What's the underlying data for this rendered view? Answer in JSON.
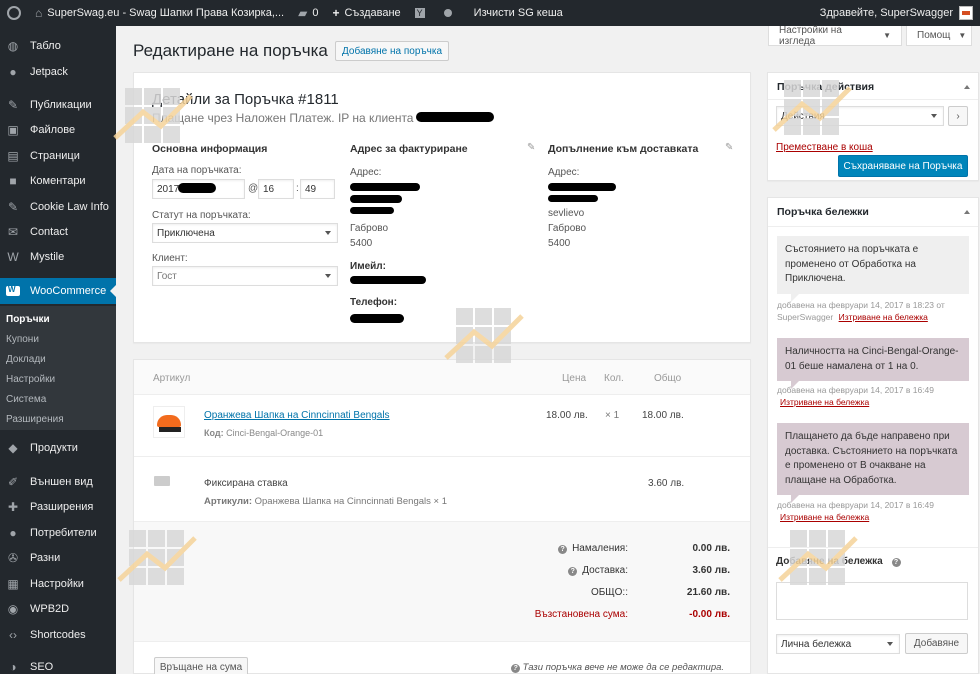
{
  "adminbar": {
    "site_name": "SuperSwag.eu - Swag Шапки Права Козирка,...",
    "comments_count": "0",
    "new_label": "Създаване",
    "purge_label": "Изчисти SG кеша",
    "greeting": "Здравейте, SuperSwagger"
  },
  "sidebar": {
    "items": [
      {
        "label": "Табло",
        "icon": "dashboard-icon",
        "glyph": "◍"
      },
      {
        "label": "Jetpack",
        "icon": "jetpack-icon",
        "glyph": "●"
      },
      {
        "label": "Публикации",
        "icon": "pin-icon",
        "glyph": "✎"
      },
      {
        "label": "Файлове",
        "icon": "media-icon",
        "glyph": "▣"
      },
      {
        "label": "Страници",
        "icon": "page-icon",
        "glyph": "▤"
      },
      {
        "label": "Коментари",
        "icon": "comment-icon",
        "glyph": "■"
      },
      {
        "label": "Cookie Law Info",
        "icon": "pin-icon",
        "glyph": "✎"
      },
      {
        "label": "Contact",
        "icon": "mail-icon",
        "glyph": "✉"
      },
      {
        "label": "Mystile",
        "icon": "theme-icon",
        "glyph": "W"
      },
      {
        "label": "WooCommerce",
        "icon": "woocommerce-icon",
        "glyph": ""
      },
      {
        "label": "Продукти",
        "icon": "cube-icon",
        "glyph": "◆"
      },
      {
        "label": "Външен вид",
        "icon": "brush-icon",
        "glyph": "✐"
      },
      {
        "label": "Разширения",
        "icon": "plugin-icon",
        "glyph": "✚"
      },
      {
        "label": "Потребители",
        "icon": "user-icon",
        "glyph": "●"
      },
      {
        "label": "Разни",
        "icon": "wrench-icon",
        "glyph": "✇"
      },
      {
        "label": "Настройки",
        "icon": "settings-icon",
        "glyph": "▦"
      },
      {
        "label": "WPB2D",
        "icon": "wpb2d-icon",
        "glyph": "◉"
      },
      {
        "label": "Shortcodes",
        "icon": "code-icon",
        "glyph": "‹›"
      },
      {
        "label": "SEO",
        "icon": "seo-icon",
        "glyph": "◑"
      }
    ],
    "submenu": [
      "Поръчки",
      "Купони",
      "Доклади",
      "Настройки",
      "Система",
      "Разширения"
    ]
  },
  "screen": {
    "options_label": "Настройки на изгледа",
    "help_label": "Помощ"
  },
  "page": {
    "title": "Редактиране на поръчка",
    "add_order_label": "Добавяне на поръчка"
  },
  "order": {
    "heading": "Детайли за Поръчка #1811",
    "payment_line": "Плащане чрез Наложен Платеж. IP на клиента",
    "general_title": "Основна информация",
    "date_label": "Дата на поръчката:",
    "date_value": "2017",
    "hour_value": "16",
    "minute_value": "49",
    "at_symbol": "@",
    "colon": ":",
    "status_label": "Статут на поръчката:",
    "status_value": "Приключена",
    "client_label": "Клиент:",
    "client_value": "Гост",
    "billing_title": "Адрес за фактуриране",
    "billing_address_label": "Адрес:",
    "billing_city": "Габрово",
    "billing_zip": "5400",
    "email_label": "Имейл:",
    "phone_label": "Телефон:",
    "shipping_title": "Допълнение към доставката",
    "shipping_address_label": "Адрес:",
    "shipping_line1": "sevlievo",
    "shipping_city": "Габрово",
    "shipping_zip": "5400"
  },
  "items": {
    "headers": {
      "item": "Артикул",
      "price": "Цена",
      "qty": "Кол.",
      "total": "Общо"
    },
    "product": {
      "name": "Оранжева Шапка на Cinncinnati Bengals",
      "sku_label": "Код:",
      "sku": "Cinci-Bengal-Orange-01",
      "price": "18.00 лв.",
      "qty": "× 1",
      "total": "18.00 лв."
    },
    "shipping": {
      "name": "Фиксирана ставка",
      "items_label": "Артикули:",
      "items_value": "Оранжева Шапка на Cinncinnati Bengals × 1",
      "total": "3.60 лв."
    },
    "totals": [
      {
        "label": "Намаления:",
        "value": "0.00 лв."
      },
      {
        "label": "Доставка:",
        "value": "3.60 лв."
      },
      {
        "label": "ОБЩО::",
        "value": "21.60 лв."
      },
      {
        "label": "Възстановена сума:",
        "value": "-0.00 лв."
      }
    ],
    "refund_button": "Връщане на сума",
    "locked_note": "Тази поръчка вече не може да се редактира."
  },
  "actions": {
    "title": "Поръчка действия",
    "select_value": "Действия",
    "trash_link": "Преместване в кошa",
    "save_button": "Съхраняване на Поръчка"
  },
  "notes": {
    "title": "Поръчка бележки",
    "list": [
      {
        "text": "Състоянието на поръчката е променено от Обработка на Приключена.",
        "meta": "добавена на февруари 14, 2017 в 18:23 от SuperSwagger",
        "delete": "Изтриване на бележка"
      },
      {
        "text": "Наличността на Cinci-Bengal-Orange-01 беше намалена от 1 на 0.",
        "meta": "добавена на февруари 14, 2017 в 16:49",
        "delete": "Изтриване на бележка"
      },
      {
        "text": "Плащането да бъде направено при доставка. Състоянието на поръчката е променено от В очакване на плащане на Обработка.",
        "meta": "добавена на февруари 14, 2017 в 16:49",
        "delete": "Изтриване на бележка"
      }
    ],
    "add_label": "Добавяне на бележка",
    "note_type": "Лична бележка",
    "add_button": "Добавяне"
  },
  "colors": {
    "accent": "#0073aa",
    "admin_bg": "#23282d",
    "note_customer": "#d7cad2",
    "danger": "#a00"
  }
}
